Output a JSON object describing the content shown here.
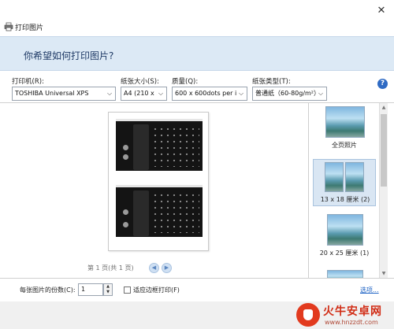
{
  "window": {
    "title": "打印图片",
    "close_glyph": "✕"
  },
  "header": {
    "question": "你希望如何打印图片?"
  },
  "settings": {
    "printer": {
      "label": "打印机(R):",
      "value": "TOSHIBA Universal XPS"
    },
    "paper_size": {
      "label": "纸张大小(S):",
      "value": "A4 (210 x 2"
    },
    "quality": {
      "label": "质量(Q):",
      "value": "600 x 600dots per in"
    },
    "paper_type": {
      "label": "纸张类型(T):",
      "value": "普通纸（60-80g/m²）"
    }
  },
  "help": {
    "glyph": "?"
  },
  "preview": {
    "page_info": "第 1 页(共 1 页)",
    "prev_glyph": "◀",
    "next_glyph": "▶"
  },
  "layouts": [
    {
      "label": "全页照片",
      "selected": false
    },
    {
      "label": "13 x 18 厘米 (2)",
      "selected": true
    },
    {
      "label": "20 x 25 厘米 (1)",
      "selected": false
    }
  ],
  "footer": {
    "copies_label": "每张图片的份数(C):",
    "copies_value": "1",
    "fit_label": "适应边框打印(F)",
    "fit_checked": false,
    "options_link": "选项..."
  },
  "watermark": {
    "name": "火牛安卓网",
    "url": "www.hnzzdt.com"
  },
  "icons": {
    "close": "close-icon",
    "printer": "printer-icon",
    "help": "help-icon",
    "dropdown": "chevron-down-icon",
    "prev": "prev-page-icon",
    "next": "next-page-icon"
  },
  "colors": {
    "banner_bg": "#dce9f5",
    "banner_text": "#1f3a66",
    "help_blue": "#2f6bc4",
    "selected_bg": "#d9e6f3",
    "link": "#1d62c4",
    "watermark_red": "#d12c15"
  }
}
